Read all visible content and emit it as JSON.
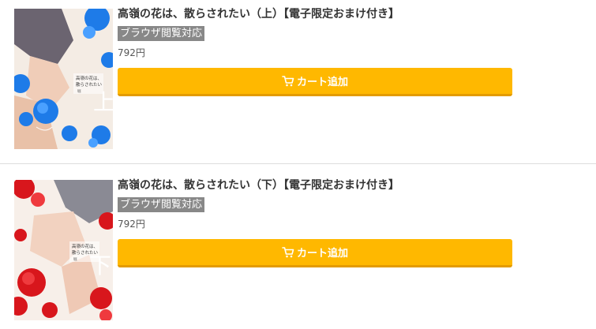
{
  "items": [
    {
      "title": "高嶺の花は、散らされたい（上）【電子限定おまけ付き】",
      "badge": "ブラウザ閲覧対応",
      "price": "792円",
      "cart_label": "カート追加",
      "cover": {
        "title_text": "高嶺の花は、散らされたい",
        "volume_char": "上",
        "flower_color": "#1e7be8"
      }
    },
    {
      "title": "高嶺の花は、散らされたい（下）【電子限定おまけ付き】",
      "badge": "ブラウザ閲覧対応",
      "price": "792円",
      "cart_label": "カート追加",
      "cover": {
        "title_text": "高嶺の花は、散らされたい",
        "volume_char": "下",
        "flower_color": "#d8161c"
      }
    }
  ],
  "colors": {
    "cart_button": "#ffb800",
    "badge_bg": "#888888"
  }
}
